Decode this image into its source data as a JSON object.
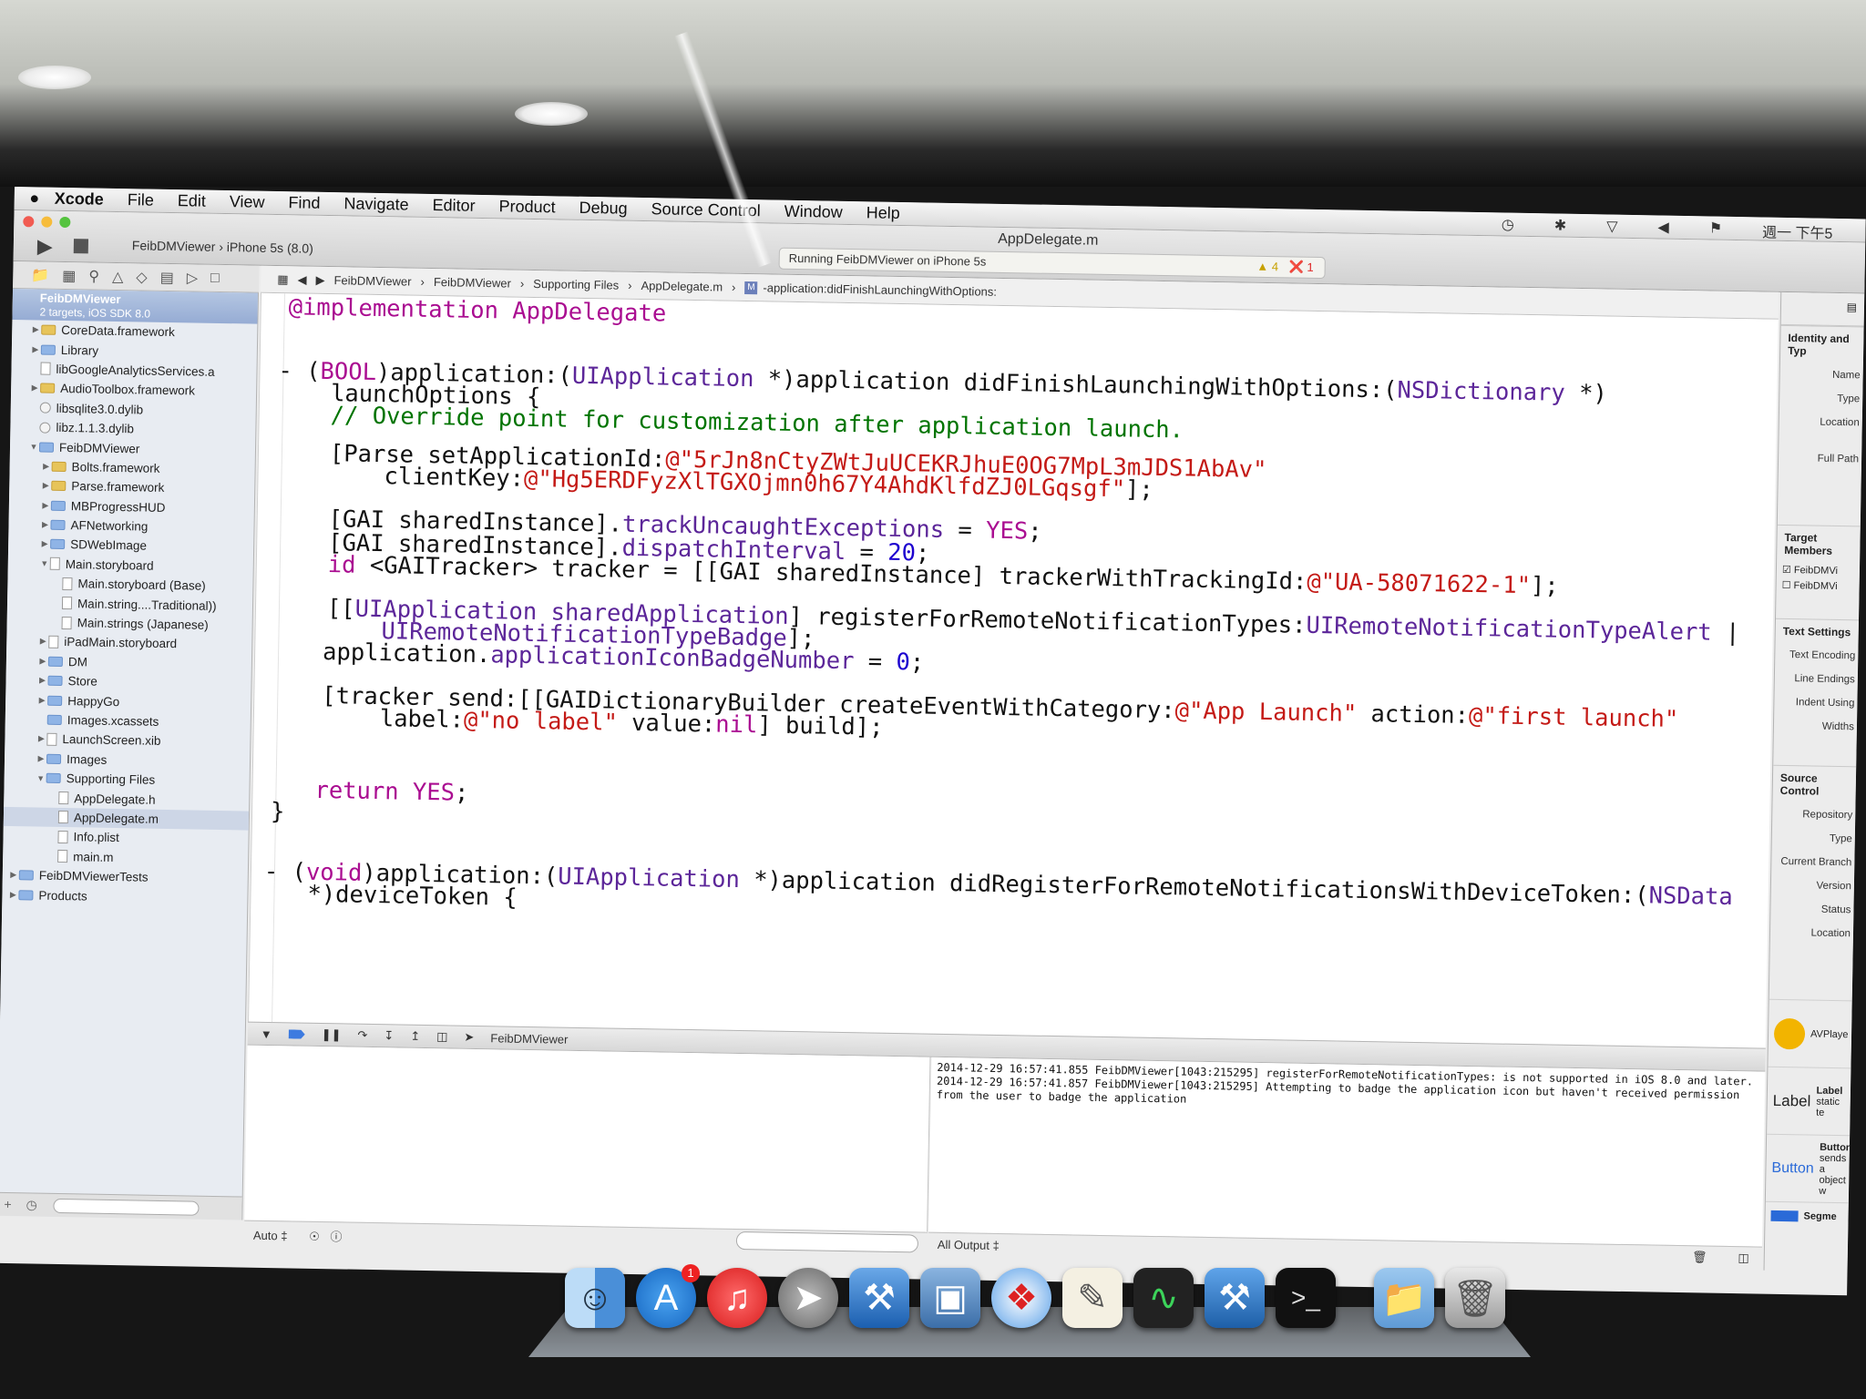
{
  "menu": {
    "app": "Xcode",
    "items": [
      "File",
      "Edit",
      "View",
      "Find",
      "Navigate",
      "Editor",
      "Product",
      "Debug",
      "Source Control",
      "Window",
      "Help"
    ],
    "clock": "週一 下午5"
  },
  "toolbar": {
    "scheme": "FeibDMViewer",
    "device": "iPhone 5s (8.0)",
    "window_title": "AppDelegate.m",
    "activity": "Running FeibDMViewer on iPhone 5s",
    "warnings": "4",
    "errors": "1"
  },
  "navigator": {
    "project": "FeibDMViewer",
    "subtitle": "2 targets, iOS SDK 8.0",
    "items": [
      {
        "label": "CoreData.framework",
        "indent": 1,
        "kind": "framework",
        "tri": "▶"
      },
      {
        "label": "Library",
        "indent": 1,
        "kind": "folder",
        "tri": "▶"
      },
      {
        "label": "libGoogleAnalyticsServices.a",
        "indent": 1,
        "kind": "file",
        "tri": ""
      },
      {
        "label": "AudioToolbox.framework",
        "indent": 1,
        "kind": "framework",
        "tri": "▶"
      },
      {
        "label": "libsqlite3.0.dylib",
        "indent": 1,
        "kind": "lib",
        "tri": ""
      },
      {
        "label": "libz.1.1.3.dylib",
        "indent": 1,
        "kind": "lib",
        "tri": ""
      },
      {
        "label": "FeibDMViewer",
        "indent": 1,
        "kind": "folder",
        "tri": "▼"
      },
      {
        "label": "Bolts.framework",
        "indent": 2,
        "kind": "framework",
        "tri": "▶"
      },
      {
        "label": "Parse.framework",
        "indent": 2,
        "kind": "framework",
        "tri": "▶"
      },
      {
        "label": "MBProgressHUD",
        "indent": 2,
        "kind": "folder",
        "tri": "▶"
      },
      {
        "label": "AFNetworking",
        "indent": 2,
        "kind": "folder",
        "tri": "▶"
      },
      {
        "label": "SDWebImage",
        "indent": 2,
        "kind": "folder",
        "tri": "▶"
      },
      {
        "label": "Main.storyboard",
        "indent": 2,
        "kind": "file",
        "tri": "▼"
      },
      {
        "label": "Main.storyboard (Base)",
        "indent": 3,
        "kind": "file",
        "tri": ""
      },
      {
        "label": "Main.string....Traditional))",
        "indent": 3,
        "kind": "file",
        "tri": ""
      },
      {
        "label": "Main.strings (Japanese)",
        "indent": 3,
        "kind": "file",
        "tri": ""
      },
      {
        "label": "iPadMain.storyboard",
        "indent": 2,
        "kind": "file",
        "tri": "▶"
      },
      {
        "label": "DM",
        "indent": 2,
        "kind": "folder",
        "tri": "▶"
      },
      {
        "label": "Store",
        "indent": 2,
        "kind": "folder",
        "tri": "▶"
      },
      {
        "label": "HappyGo",
        "indent": 2,
        "kind": "folder",
        "tri": "▶"
      },
      {
        "label": "Images.xcassets",
        "indent": 2,
        "kind": "folder",
        "tri": ""
      },
      {
        "label": "LaunchScreen.xib",
        "indent": 2,
        "kind": "file",
        "tri": "▶"
      },
      {
        "label": "Images",
        "indent": 2,
        "kind": "folder",
        "tri": "▶"
      },
      {
        "label": "Supporting Files",
        "indent": 2,
        "kind": "folder",
        "tri": "▼"
      },
      {
        "label": "AppDelegate.h",
        "indent": 3,
        "kind": "file",
        "tri": ""
      },
      {
        "label": "AppDelegate.m",
        "indent": 3,
        "kind": "file",
        "tri": "",
        "selected": true
      },
      {
        "label": "Info.plist",
        "indent": 3,
        "kind": "file",
        "tri": ""
      },
      {
        "label": "main.m",
        "indent": 3,
        "kind": "file",
        "tri": ""
      },
      {
        "label": "FeibDMViewerTests",
        "indent": 0,
        "kind": "folder",
        "tri": "▶"
      },
      {
        "label": "Products",
        "indent": 0,
        "kind": "folder",
        "tri": "▶"
      }
    ]
  },
  "jumpbar": {
    "crumbs": [
      "FeibDMViewer",
      "FeibDMViewer",
      "Supporting Files",
      "AppDelegate.m",
      "-application:didFinishLaunchingWithOptions:"
    ]
  },
  "code": {
    "l1": "@implementation AppDelegate",
    "l2a": "- (",
    "l2b": "BOOL",
    "l2c": ")application:(",
    "l2d": "UIApplication",
    "l2e": " *)application didFinishLaunchingWithOptions:(",
    "l2f": "NSDictionary",
    "l2g": " *)",
    "l3": "launchOptions {",
    "l4": "// Override point for customization after application launch.",
    "l5a": "[Parse setApplicationId:",
    "l5b": "@\"5rJn8nCtyZWtJuUCEKRJhuE0OG7MpL3mJDS1AbAv\"",
    "l6a": "clientKey:",
    "l6b": "@\"Hg5ERDFyzXlTGXOjmn0h67Y4AhdKlfdZJ0LGqsgf\"",
    "l6c": "];",
    "l7a": "[GAI sharedInstance].",
    "l7b": "trackUncaughtExceptions",
    "l7c": " = ",
    "l7d": "YES",
    "l7e": ";",
    "l8a": "[GAI sharedInstance].",
    "l8b": "dispatchInterval",
    "l8c": " = ",
    "l8d": "20",
    "l8e": ";",
    "l9a": "id",
    "l9b": " <GAITracker> tracker = [[GAI sharedInstance] trackerWithTrackingId:",
    "l9c": "@\"UA-58071622-1\"",
    "l9d": "];",
    "l10a": "[[",
    "l10b": "UIApplication",
    "l10c": " ",
    "l10d": "sharedApplication",
    "l10e": "] registerForRemoteNotificationTypes:",
    "l10f": "UIRemoteNotificationTypeAlert",
    "l10g": " |",
    "l11a": "UIRemoteNotificationTypeBadge",
    "l11b": "];",
    "l12a": "application.",
    "l12b": "applicationIconBadgeNumber",
    "l12c": " = ",
    "l12d": "0",
    "l12e": ";",
    "l13a": "[tracker send:[[GAIDictionaryBuilder createEventWithCategory:",
    "l13b": "@\"App Launch\"",
    "l13c": " action:",
    "l13d": "@\"first launch\"",
    "l14a": "label:",
    "l14b": "@\"no label\"",
    "l14c": " value:",
    "l14d": "nil",
    "l14e": "] build];",
    "l15a": "return",
    "l15b": " YES",
    "l15c": ";",
    "l16": "}",
    "l17a": "- (",
    "l17b": "void",
    "l17c": ")application:(",
    "l17d": "UIApplication",
    "l17e": " *)application didRegisterForRemoteNotificationsWithDeviceToken:(",
    "l17f": "NSData",
    "l18": "*)deviceToken {"
  },
  "debug": {
    "target": "FeibDMViewer",
    "auto": "Auto ‡",
    "output": "All Output ‡",
    "log": "2014-12-29 16:57:41.855 FeibDMViewer[1043:215295] registerForRemoteNotificationTypes: is not supported in iOS 8.0 and later.\n2014-12-29 16:57:41.857 FeibDMViewer[1043:215295] Attempting to badge the application icon but haven't received permission from the user to badge the application"
  },
  "inspector": {
    "identity": "Identity and Typ",
    "name": "Name",
    "type": "Type",
    "location": "Location",
    "full_path": "Full Path",
    "target_membership": "Target Members",
    "target1": "FeibDMVi",
    "target2": "FeibDMVi",
    "text_settings": "Text Settings",
    "encoding": "Text Encoding",
    "endings": "Line Endings",
    "indent": "Indent Using",
    "widths": "Widths",
    "source_control": "Source Control",
    "repository": "Repository",
    "sc_type": "Type",
    "branch": "Current Branch",
    "version": "Version",
    "status": "Status",
    "sc_location": "Location",
    "lib1_title": "AVPlaye",
    "lib2_big": "Label",
    "lib2_title": "Label",
    "lib2_desc": "static te",
    "lib3_big": "Button",
    "lib3_title": "Button",
    "lib3_desc": "sends a",
    "lib3_desc2": "object w",
    "lib4_title": "Segme"
  }
}
